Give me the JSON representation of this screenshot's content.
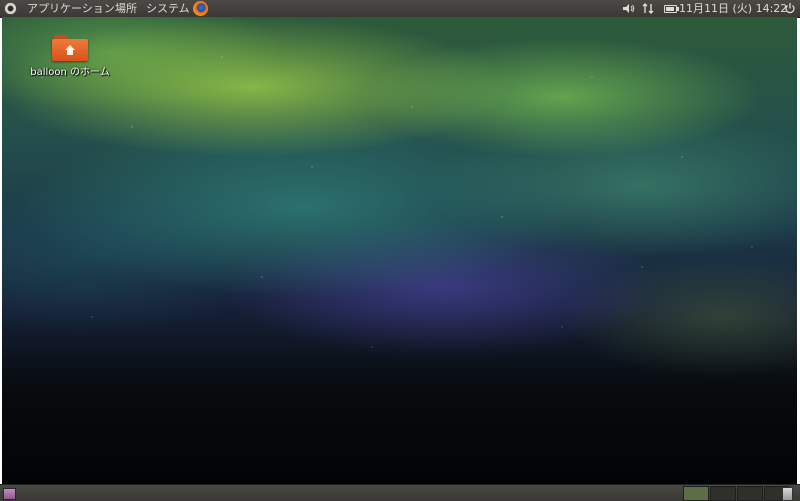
{
  "top_panel": {
    "menus": {
      "applications": "アプリケーション",
      "places": "場所",
      "system": "システム"
    },
    "launchers": [
      "firefox-icon"
    ],
    "tray": {
      "icons": [
        "speaker-icon",
        "network-arrows-icon",
        "battery-icon",
        "power-icon"
      ],
      "clock": "11月11日 (火) 14:22"
    }
  },
  "desktop": {
    "wallpaper": "aurora",
    "icons": [
      {
        "label": "balloon のホーム",
        "icon": "home-folder-icon"
      }
    ]
  },
  "bottom_panel": {
    "workspaces": {
      "count": 4,
      "active": 1
    },
    "icons": [
      "show-desktop-icon",
      "trash-icon"
    ]
  }
}
